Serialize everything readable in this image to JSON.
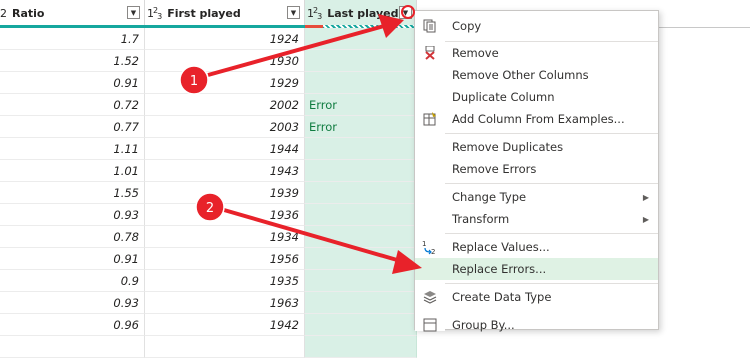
{
  "columns": [
    {
      "type_prefix": "2",
      "name": "Ratio"
    },
    {
      "type_prefix": "123",
      "name": "First played"
    },
    {
      "type_prefix": "123",
      "name": "Last played"
    }
  ],
  "rows": [
    {
      "ratio": "1.7",
      "first": "1924",
      "last": ""
    },
    {
      "ratio": "1.52",
      "first": "1930",
      "last": ""
    },
    {
      "ratio": "0.91",
      "first": "1929",
      "last": ""
    },
    {
      "ratio": "0.72",
      "first": "2002",
      "last": "Error"
    },
    {
      "ratio": "0.77",
      "first": "2003",
      "last": "Error"
    },
    {
      "ratio": "1.11",
      "first": "1944",
      "last": ""
    },
    {
      "ratio": "1.01",
      "first": "1943",
      "last": ""
    },
    {
      "ratio": "1.55",
      "first": "1939",
      "last": ""
    },
    {
      "ratio": "0.93",
      "first": "1936",
      "last": ""
    },
    {
      "ratio": "0.78",
      "first": "1934",
      "last": ""
    },
    {
      "ratio": "0.91",
      "first": "1956",
      "last": ""
    },
    {
      "ratio": "0.9",
      "first": "1935",
      "last": ""
    },
    {
      "ratio": "0.93",
      "first": "1963",
      "last": ""
    },
    {
      "ratio": "0.96",
      "first": "1942",
      "last": ""
    },
    {
      "ratio": "",
      "first": "",
      "last": ""
    }
  ],
  "menu": {
    "copy": "Copy",
    "remove": "Remove",
    "remove_other_columns": "Remove Other Columns",
    "duplicate_column": "Duplicate Column",
    "add_column_from_examples": "Add Column From Examples...",
    "remove_duplicates": "Remove Duplicates",
    "remove_errors": "Remove Errors",
    "change_type": "Change Type",
    "transform": "Transform",
    "replace_values": "Replace Values...",
    "replace_errors": "Replace Errors...",
    "create_data_type": "Create Data Type",
    "group_by": "Group By..."
  },
  "annotations": {
    "callout_1": "1",
    "callout_2": "2",
    "arrow_color": "#e8222a"
  },
  "colors": {
    "accent": "#16a79e",
    "selected_column": "#d9f0e6",
    "error_text": "#107c41",
    "highlight": "#dff2e4"
  }
}
